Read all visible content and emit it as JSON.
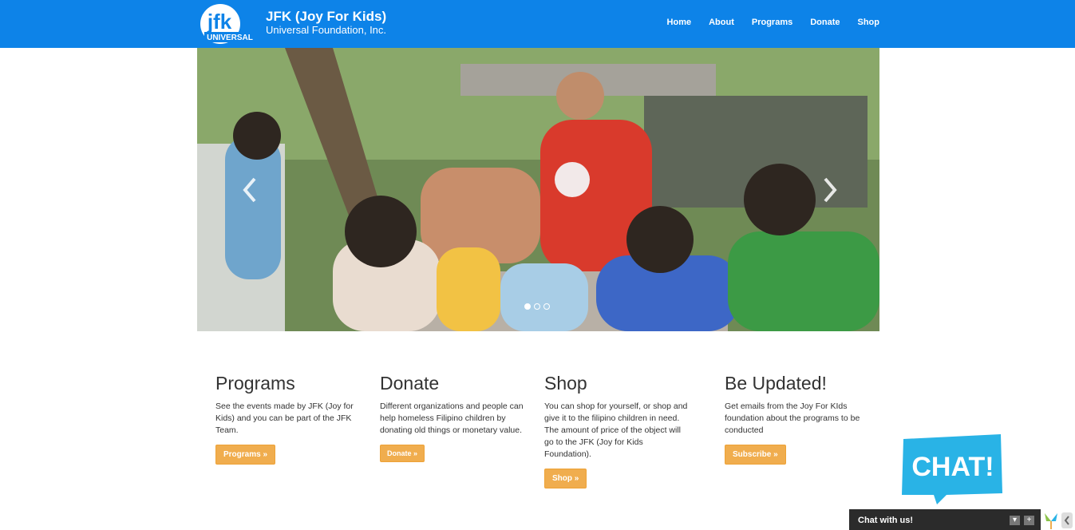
{
  "brand": {
    "logo_text": "jfk",
    "logo_subtext": "UNIVERSAL",
    "title": "JFK (Joy For Kids)",
    "subtitle": "Universal Foundation, Inc."
  },
  "nav": {
    "items": [
      "Home",
      "About",
      "Programs",
      "Donate",
      "Shop"
    ]
  },
  "carousel": {
    "slide_count": 3,
    "active_index": 0,
    "prev_icon": "chevron-left-icon",
    "next_icon": "chevron-right-icon"
  },
  "sections": [
    {
      "heading": "Programs",
      "text": "See the events made by JFK (Joy for Kids) and you can be part of the JFK Team.",
      "button": "Programs »"
    },
    {
      "heading": "Donate",
      "text": "Different organizations and people can help homeless Filipino children by donating old things or monetary value.",
      "button": "Donate »"
    },
    {
      "heading": "Shop",
      "text": "You can shop for yourself, or shop and give it to the filipino children in need. The amount of price of the object will go to the JFK (Joy for Kids Foundation).",
      "button": "Shop »"
    },
    {
      "heading": "Be Updated!",
      "text": "Get emails from the Joy For KIds foundation about the programs to be conducted",
      "button": "Subscribe »"
    }
  ],
  "chat": {
    "bubble_text": "CHAT!",
    "bar_label": "Chat with us!"
  },
  "colors": {
    "nav_bg": "#0d83e8",
    "button": "#f0ad4e",
    "chat_bubble": "#29b3e6",
    "chat_bar": "#2b2b2b"
  }
}
